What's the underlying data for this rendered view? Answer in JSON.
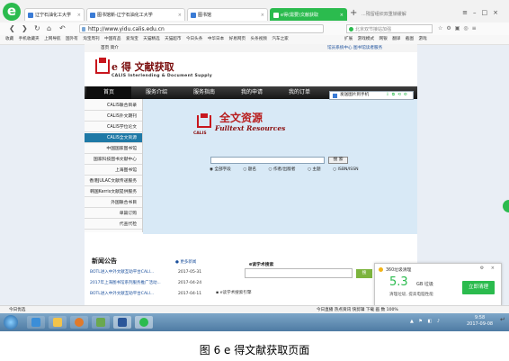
{
  "browser": {
    "tabs": [
      {
        "label": "辽宁石油化工大学"
      },
      {
        "label": "图书馆新-辽宁石油化工大学"
      },
      {
        "label": "图书馆"
      },
      {
        "label": "e得(需要)文献获取"
      }
    ],
    "new_tab": "+",
    "tab_search": "...残留组织双重锁缓解",
    "url": "http://www.yidu.calis.edu.cn",
    "right_search": "北京双节接站加强",
    "bookmarks_left": [
      "收藏",
      "手机收藏夹",
      "上网导航",
      "国外有",
      "淘宝周刊",
      "中国有品",
      "爱淘宝",
      "天猫精选",
      "天猫超市",
      "今日头条",
      "中华日本",
      "好易网页",
      "头条视频",
      "汽车之家"
    ],
    "bookmarks_right": [
      "扩展",
      "游戏模式",
      "网银",
      "翻译",
      "截图",
      "游戏"
    ]
  },
  "site": {
    "top_left": "首页    简介",
    "top_right": "馆员系统中心    图书馆读者服务",
    "brand_title": "e 得 文献获取",
    "brand_subtitle": "CALIS Interlending & Document Supply",
    "nav": [
      "首页",
      "服务介绍",
      "服务指南",
      "我的申请",
      "我的订单"
    ],
    "sidebar": [
      "CALIS联合目录",
      "CALIS外文期刊",
      "CALIS学位论文",
      "CALIS全文资源",
      "中国国家图书馆",
      "国家科技图书文献中心",
      "上海图书馆",
      "香港JULAC文献传递服务",
      "韩国Kerris文献提供服务",
      "外国联合书目",
      "单篇订购",
      "代查代检"
    ],
    "active_sidebar": 3,
    "resource": {
      "cn_title": "全文资源",
      "en_title": "Fulltext Resources",
      "emblem_label": "CALIS",
      "search_button": "搜 索",
      "radio_options": [
        "全部字段",
        "题名",
        "作者/出版者",
        "主题",
        "ISBN/ISSN"
      ]
    },
    "overlay_toolbar": "发送图片到手机"
  },
  "news": {
    "title": "新闻公告",
    "more": "更多新闻",
    "items": [
      {
        "title": "BOTL进入中外文献互助平台CALI...",
        "date": "2017-05-31"
      },
      {
        "title": "2017年上海图书馆系列服务推广活动...",
        "date": "2017-04-24"
      },
      {
        "title": "BOTL进入中外文献互助平台CALI...",
        "date": "2017-04-11"
      }
    ],
    "ebook_label": "e读学术搜索",
    "ebook_button": "搜",
    "ebook_guide": "e读学术搜索引擎"
  },
  "popup": {
    "title": "360垃圾清理",
    "size_value": "5.3",
    "size_unit": "GB 垃圾",
    "desc": "清理垃圾, 提高电脑性能",
    "button": "立即清理"
  },
  "statusbar": {
    "left": "今日优选",
    "right": "今日直播    热点资讯    快剪辑    下载    画    数  100%"
  },
  "taskbar": {
    "time": "9:58",
    "date": "2017-09-08"
  },
  "caption": "图 6   e 得文献获取页面"
}
